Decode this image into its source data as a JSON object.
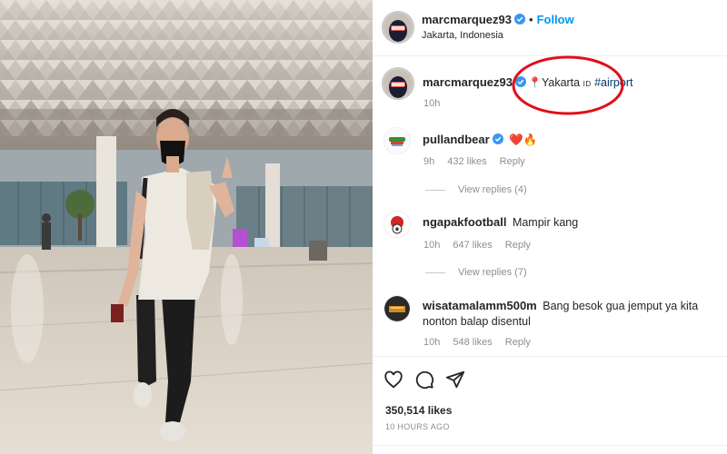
{
  "post": {
    "username": "marcmarquez93",
    "follow_label": "Follow",
    "location": "Jakarta, Indonesia",
    "caption": {
      "username": "marcmarquez93",
      "place_text": "Yakarta",
      "flag_text": "ID",
      "hashtag": "#airport",
      "time": "10h"
    }
  },
  "comments": [
    {
      "username": "pullandbear",
      "text": "❤️🔥",
      "time": "9h",
      "likes": "432 likes",
      "reply": "Reply",
      "view_replies": "View replies (4)"
    },
    {
      "username": "ngapakfootball",
      "text": "Mampir kang",
      "time": "10h",
      "likes": "647 likes",
      "reply": "Reply",
      "view_replies": "View replies (7)"
    },
    {
      "username": "wisatamalamm500m",
      "text": "Bang besok gua jemput ya kita nonton balap disentul",
      "time": "10h",
      "likes": "548 likes",
      "reply": "Reply"
    }
  ],
  "footer": {
    "likes_count": "350,514 likes",
    "timestamp": "10 HOURS AGO"
  },
  "icons": {
    "like": "heart-outline-icon",
    "comment": "comment-icon",
    "share": "send-icon",
    "verified": "verified-badge-icon"
  },
  "colors": {
    "link": "#0095f6",
    "annotation": "#e0101a",
    "verified": "#3897f0",
    "hashtag": "#00376b"
  }
}
